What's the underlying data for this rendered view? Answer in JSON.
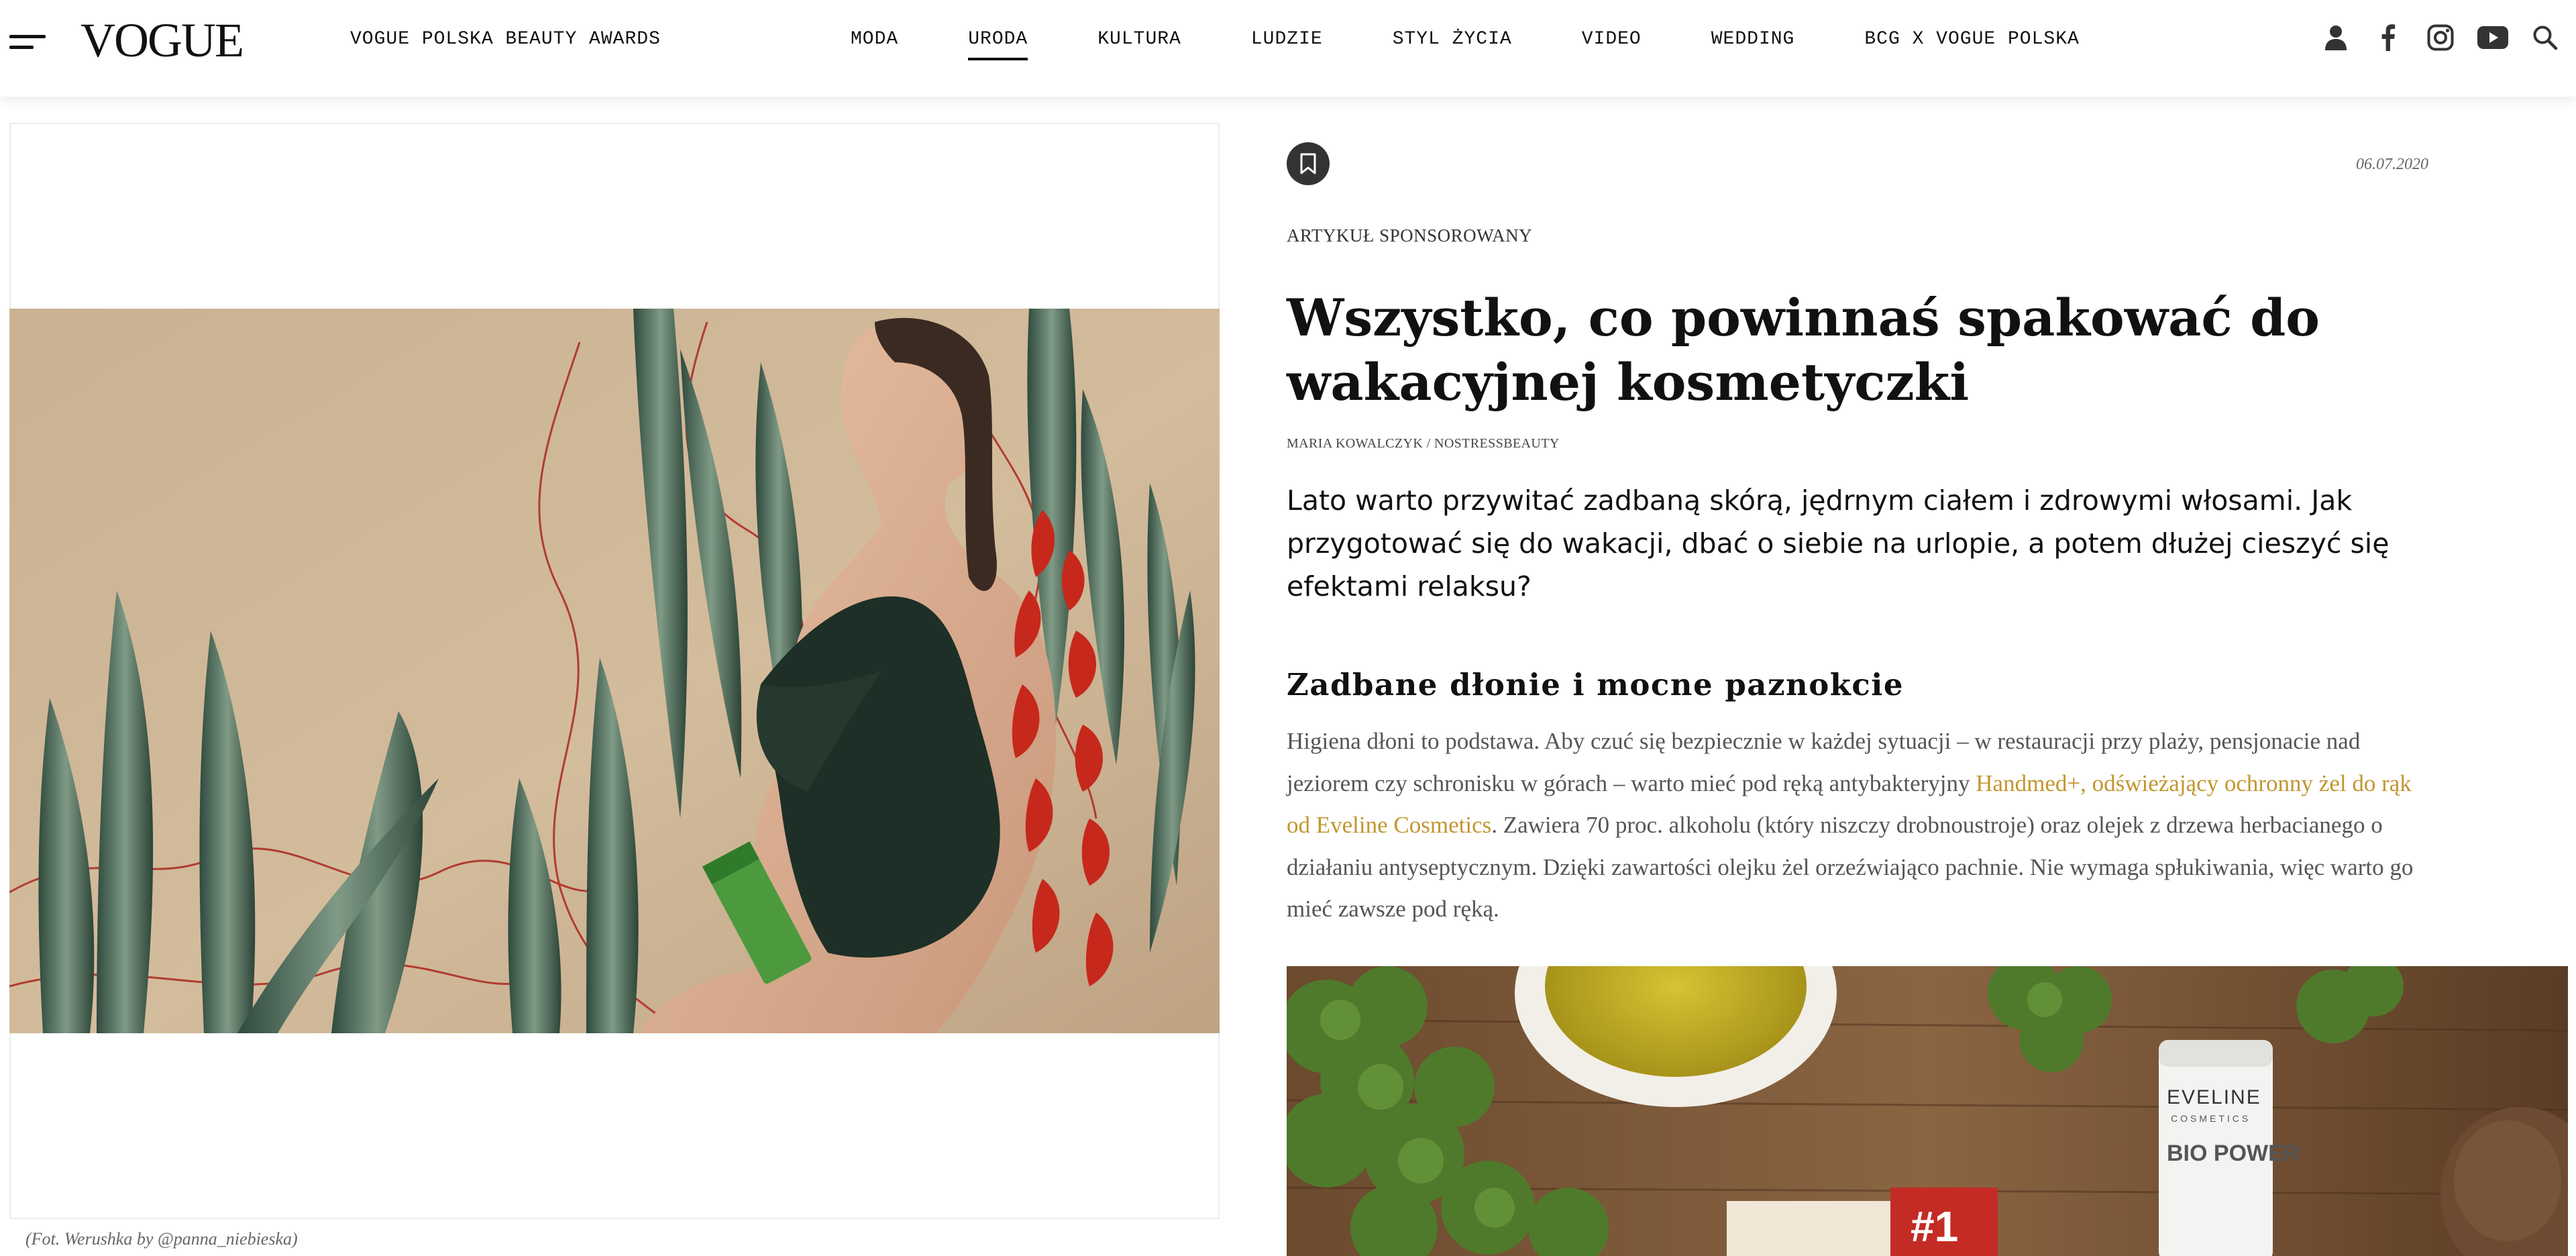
{
  "header": {
    "logo": "VOGUE",
    "awards_link": "VOGUE POLSKA BEAUTY AWARDS",
    "nav": [
      "MODA",
      "URODA",
      "KULTURA",
      "LUDZIE",
      "STYL ŻYCIA",
      "VIDEO",
      "WEDDING",
      "BCG X VOGUE POLSKA"
    ],
    "active_nav": "URODA",
    "icons": [
      "user-icon",
      "facebook-icon",
      "instagram-icon",
      "youtube-icon",
      "search-icon"
    ]
  },
  "hero": {
    "caption": "(Fot. Werushka by @panna_niebieska)",
    "image": "woman-in-green-swimsuit-with-plants-photo"
  },
  "article": {
    "date": "06.07.2020",
    "label": "ARTYKUŁ SPONSOROWANY",
    "title": "Wszystko, co powinnaś spakować do wakacyjnej kosmetyczki",
    "author": "MARIA KOWALCZYK / NOSTRESSBEAUTY",
    "lead": "Lato warto przywitać zadbaną skórą, jędrnym ciałem i zdrowymi włosami. Jak przygotować się do wakacji, dbać o siebie na urlopie, a potem dłużej cieszyć się efektami relaksu?",
    "section_title": "Zadbane dłonie i mocne paznokcie",
    "body_before_link": "Higiena dłoni to podstawa. Aby czuć się bezpiecznie w każdej sytuacji – w restauracji przy plaży, pensjonacie nad jeziorem czy schronisku w górach – warto mieć pod ręką antybakteryjny ",
    "body_link": "Handmed+, odświeżający ochronny żel do rąk od Eveline Cosmetics",
    "body_after_link": ". Zawiera 70 proc. alkoholu (który niszczy drobnoustroje) oraz olejek z drzewa herbacianego o działaniu antyseptycznym. Dzięki zawartości olejku żel orzeźwiająco pachnie. Nie wymaga spłukiwania, więc warto go mieć zawsze pod ręką.",
    "product_image": {
      "brand_text": "EVELINE",
      "brand_sub": "COSMETICS",
      "product_line": "BIO POWER",
      "badge": "#1"
    }
  },
  "colors": {
    "link": "#c2962f",
    "text": "#111111",
    "body": "#555555"
  }
}
